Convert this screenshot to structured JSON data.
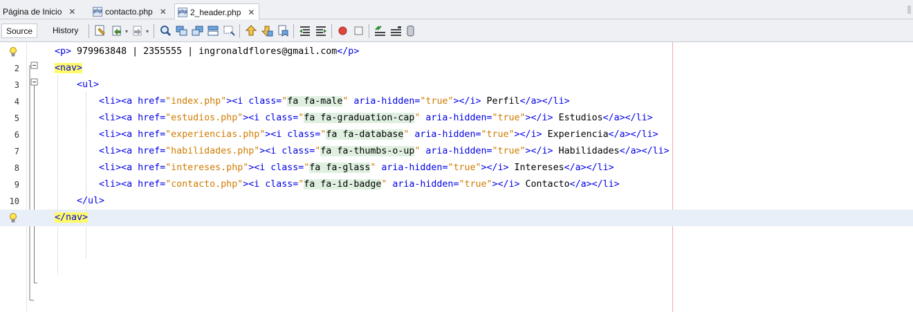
{
  "tabs": [
    {
      "label": "Página de Inicio",
      "icon": "",
      "active": false
    },
    {
      "label": "contacto.php",
      "icon": "php-file-icon",
      "active": false
    },
    {
      "label": "2_header.php",
      "icon": "php-file-icon",
      "active": true
    }
  ],
  "tab_close_glyph": "✕",
  "toolbar": {
    "source_label": "Source",
    "history_label": "History",
    "icons": [
      "last-edit-icon",
      "back-icon",
      "forward-icon",
      "find-selection-icon",
      "find-previous-icon",
      "find-next-icon",
      "toggle-highlight-icon",
      "toggle-rectangular-selection-icon",
      "previous-bookmark-icon",
      "next-bookmark-icon",
      "toggle-bookmark-icon",
      "shift-left-icon",
      "shift-right-icon",
      "start-macro-icon",
      "stop-macro-icon",
      "comment-icon",
      "uncomment-icon",
      "database-icon"
    ]
  },
  "editor": {
    "lines": [
      {
        "num": "",
        "marker": "bulb",
        "parts": [
          [
            "tag",
            "<p>"
          ],
          [
            "txt",
            " 979963848 | 2355555 | ingronaldflores@gmail.com"
          ],
          [
            "tag",
            "</p>"
          ]
        ]
      },
      {
        "num": "2",
        "marker": "",
        "parts": [
          [
            "hl",
            "<nav>"
          ]
        ]
      },
      {
        "num": "3",
        "marker": "",
        "parts": [
          [
            "txt",
            "    "
          ],
          [
            "tag",
            "<ul>"
          ]
        ]
      },
      {
        "num": "4",
        "marker": "",
        "parts": [
          [
            "txt",
            "        "
          ],
          [
            "tag",
            "<li><a href="
          ],
          [
            "atv",
            "\"index.php\""
          ],
          [
            "tag",
            "><i class="
          ],
          [
            "atv",
            "\""
          ],
          [
            "cls",
            "fa fa-male"
          ],
          [
            "atv",
            "\""
          ],
          [
            "tag",
            " aria-hidden="
          ],
          [
            "atv",
            "\"true\""
          ],
          [
            "tag",
            "></i>"
          ],
          [
            "txt",
            " Perfil"
          ],
          [
            "tag",
            "</a></li>"
          ]
        ]
      },
      {
        "num": "5",
        "marker": "",
        "parts": [
          [
            "txt",
            "        "
          ],
          [
            "tag",
            "<li><a href="
          ],
          [
            "atv",
            "\"estudios.php\""
          ],
          [
            "tag",
            "><i class="
          ],
          [
            "atv",
            "\""
          ],
          [
            "cls",
            "fa fa-graduation-cap"
          ],
          [
            "atv",
            "\""
          ],
          [
            "tag",
            " aria-hidden="
          ],
          [
            "atv",
            "\"true\""
          ],
          [
            "tag",
            "></i>"
          ],
          [
            "txt",
            " Estudios"
          ],
          [
            "tag",
            "</a></li>"
          ]
        ]
      },
      {
        "num": "6",
        "marker": "",
        "parts": [
          [
            "txt",
            "        "
          ],
          [
            "tag",
            "<li><a href="
          ],
          [
            "atv",
            "\"experiencias.php\""
          ],
          [
            "tag",
            "><i class="
          ],
          [
            "atv",
            "\""
          ],
          [
            "cls",
            "fa fa-database"
          ],
          [
            "atv",
            "\""
          ],
          [
            "tag",
            " aria-hidden="
          ],
          [
            "atv",
            "\"true\""
          ],
          [
            "tag",
            "></i>"
          ],
          [
            "txt",
            " Experiencia"
          ],
          [
            "tag",
            "</a></li>"
          ]
        ]
      },
      {
        "num": "7",
        "marker": "",
        "parts": [
          [
            "txt",
            "        "
          ],
          [
            "tag",
            "<li><a href="
          ],
          [
            "atv",
            "\"habilidades.php\""
          ],
          [
            "tag",
            "><i class="
          ],
          [
            "atv",
            "\""
          ],
          [
            "cls",
            "fa fa-thumbs-o-up"
          ],
          [
            "atv",
            "\""
          ],
          [
            "tag",
            " aria-hidden="
          ],
          [
            "atv",
            "\"true\""
          ],
          [
            "tag",
            "></i>"
          ],
          [
            "txt",
            " Habilidades"
          ],
          [
            "tag",
            "</a></li>"
          ]
        ]
      },
      {
        "num": "8",
        "marker": "",
        "parts": [
          [
            "txt",
            "        "
          ],
          [
            "tag",
            "<li><a href="
          ],
          [
            "atv",
            "\"intereses.php\""
          ],
          [
            "tag",
            "><i class="
          ],
          [
            "atv",
            "\""
          ],
          [
            "cls",
            "fa fa-glass"
          ],
          [
            "atv",
            "\""
          ],
          [
            "tag",
            " aria-hidden="
          ],
          [
            "atv",
            "\"true\""
          ],
          [
            "tag",
            "></i>"
          ],
          [
            "txt",
            " Intereses"
          ],
          [
            "tag",
            "</a></li>"
          ]
        ]
      },
      {
        "num": "9",
        "marker": "",
        "parts": [
          [
            "txt",
            "        "
          ],
          [
            "tag",
            "<li><a href="
          ],
          [
            "atv",
            "\"contacto.php\""
          ],
          [
            "tag",
            "><i class="
          ],
          [
            "atv",
            "\""
          ],
          [
            "cls",
            "fa fa-id-badge"
          ],
          [
            "atv",
            "\""
          ],
          [
            "tag",
            " aria-hidden="
          ],
          [
            "atv",
            "\"true\""
          ],
          [
            "tag",
            "></i>"
          ],
          [
            "txt",
            " Contacto"
          ],
          [
            "tag",
            "</a></li>"
          ]
        ]
      },
      {
        "num": "10",
        "marker": "",
        "parts": [
          [
            "txt",
            "    "
          ],
          [
            "tag",
            "</ul>"
          ]
        ]
      },
      {
        "num": "",
        "marker": "bulb",
        "parts": [
          [
            "hl",
            "</nav>"
          ]
        ]
      }
    ]
  }
}
